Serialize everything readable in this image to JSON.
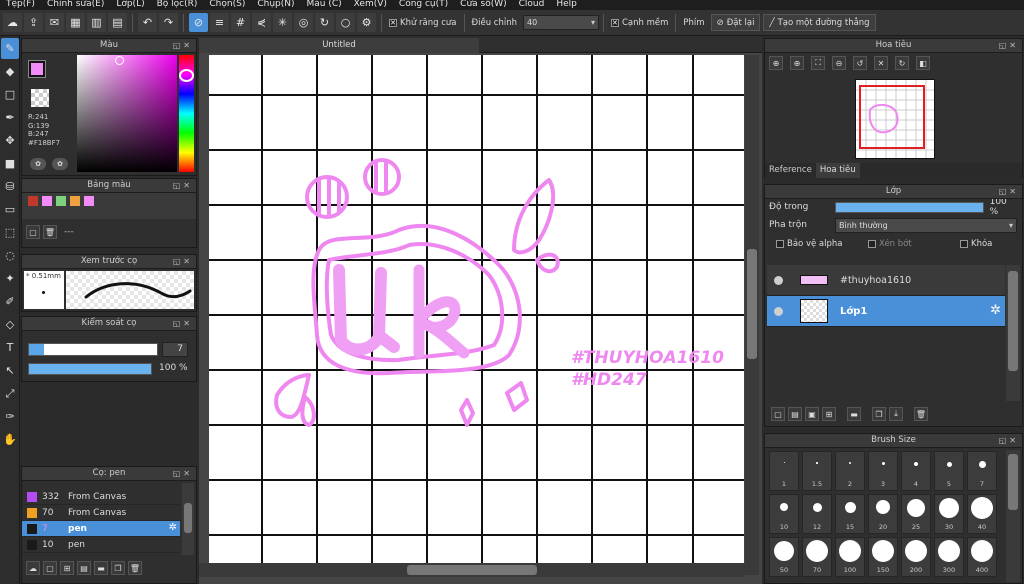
{
  "menu": [
    "Tệp(F)",
    "Chỉnh sửa(E)",
    "Lớp(L)",
    "Bộ lọc(R)",
    "Chọn(S)",
    "Chụp(N)",
    "Màu (C)",
    "Xem(V)",
    "Công cụ(T)",
    "Cửa sổ(W)",
    "Cloud",
    "Help"
  ],
  "toolbar": {
    "antialias_label": "Khử răng cưa",
    "adjust_label": "Điều chỉnh",
    "adjust_value": "40",
    "soft_edge_label": "Cạnh mềm",
    "key_label": "Phím",
    "reset_label": "Đặt lại",
    "line_label": "Tạo một đường thẳng"
  },
  "color_panel": {
    "title": "Màu",
    "primary": "#F18BF7",
    "r": "R:241",
    "g": "G:139",
    "b": "B:247",
    "hex": "#F18BF7"
  },
  "palette_panel": {
    "title": "Bảng màu",
    "colors": [
      "#c0392b",
      "#f18bf7",
      "#7fd17f",
      "#f0a040",
      "#f18bf7"
    ],
    "field_value": "---"
  },
  "brush_preview": {
    "title": "Xem trước cọ",
    "size": "* 0.51mm"
  },
  "brush_control": {
    "title": "Kiểm soát cọ",
    "size_value": "7",
    "opacity_value": "100 %",
    "opacity": 1.0,
    "size_fill": 0.12
  },
  "brush_list": {
    "title": "Cọ: pen",
    "items": [
      {
        "num": "332",
        "name": "From Canvas",
        "color": "#b44cf0"
      },
      {
        "num": "70",
        "name": "From Canvas",
        "color": "#f0a020"
      },
      {
        "num": "7",
        "name": "pen",
        "color": "#1a1a1a"
      },
      {
        "num": "10",
        "name": "pen",
        "color": "#1a1a1a"
      }
    ]
  },
  "document": {
    "tab": "Untitled",
    "text_line1": "#THUYHOA1610",
    "text_line2": "#HD247",
    "lettering": "uk"
  },
  "navigator": {
    "title": "Hoa tiêu",
    "tab_reference": "Reference",
    "tab_navigator": "Hoa tiêu"
  },
  "layer_panel": {
    "title": "Lớp",
    "opacity_label": "Độ trong",
    "opacity_value": "100 %",
    "opacity": 1.0,
    "blend_label": "Pha trộn",
    "blend_value": "Bình thường",
    "protect_alpha": "Bảo vệ alpha",
    "clipping": "Xén bớt",
    "lock": "Khóa",
    "layers": [
      {
        "name": "#thuyhoa1610",
        "selected": false
      },
      {
        "name": "Lớp1",
        "selected": true
      }
    ]
  },
  "brush_size": {
    "title": "Brush Size",
    "row1": [
      "1",
      "1.5",
      "2",
      "3",
      "4",
      "5",
      "7"
    ],
    "row2": [
      "10",
      "12",
      "15",
      "20",
      "25",
      "30",
      "40"
    ],
    "row3": [
      "50",
      "70",
      "100",
      "150",
      "200",
      "300",
      "400"
    ]
  }
}
